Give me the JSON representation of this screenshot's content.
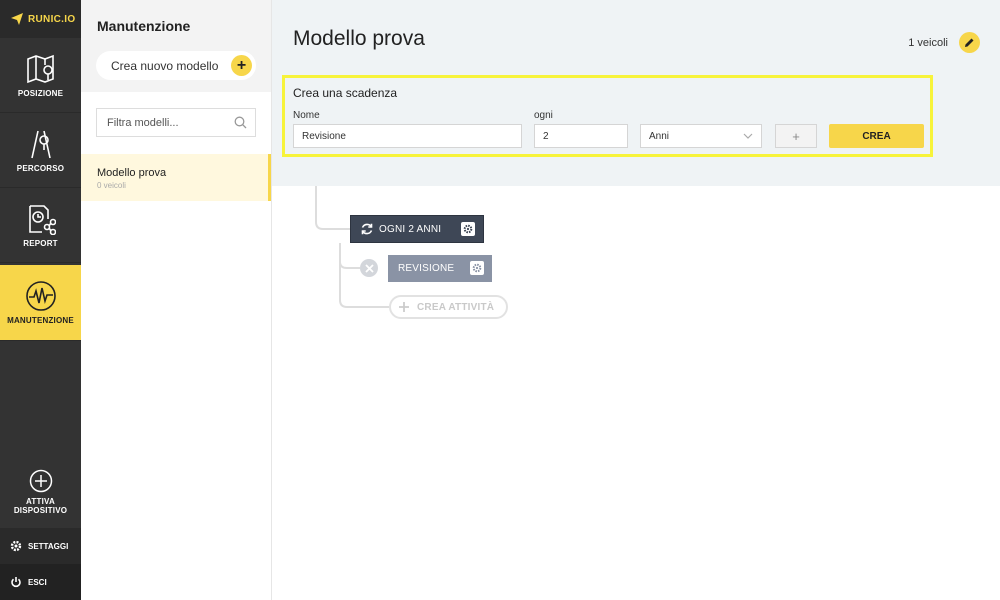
{
  "brand": {
    "name": "RUNIC.IO",
    "accent": "#f7d64a"
  },
  "nav": {
    "items": [
      {
        "label": "POSIZIONE",
        "icon": "map-icon"
      },
      {
        "label": "PERCORSO",
        "icon": "route-icon"
      },
      {
        "label": "REPORT",
        "icon": "report-icon"
      },
      {
        "label": "MANUTENZIONE",
        "icon": "maintenance-icon",
        "active": true
      }
    ],
    "activate": {
      "line1": "ATTIVA",
      "line2": "DISPOSITIVO"
    },
    "settings": "SETTAGGI",
    "logout": "ESCI"
  },
  "panel": {
    "title": "Manutenzione",
    "new_model": "Crea nuovo modello",
    "filter_placeholder": "Filtra modelli...",
    "models": [
      {
        "name": "Modello prova",
        "sub": "0 veicoli"
      }
    ]
  },
  "main": {
    "title": "Modello prova",
    "vehicles": "1 veicoli",
    "form": {
      "title": "Crea una scadenza",
      "name_label": "Nome",
      "name_value": "Revisione",
      "every_label": "ogni",
      "every_value": "2",
      "unit_value": "Anni",
      "plus": "+",
      "submit": "CREA"
    },
    "tree": {
      "interval": "OGNI 2 ANNI",
      "task": "REVISIONE",
      "add_task": "CREA ATTIVITÀ"
    }
  }
}
